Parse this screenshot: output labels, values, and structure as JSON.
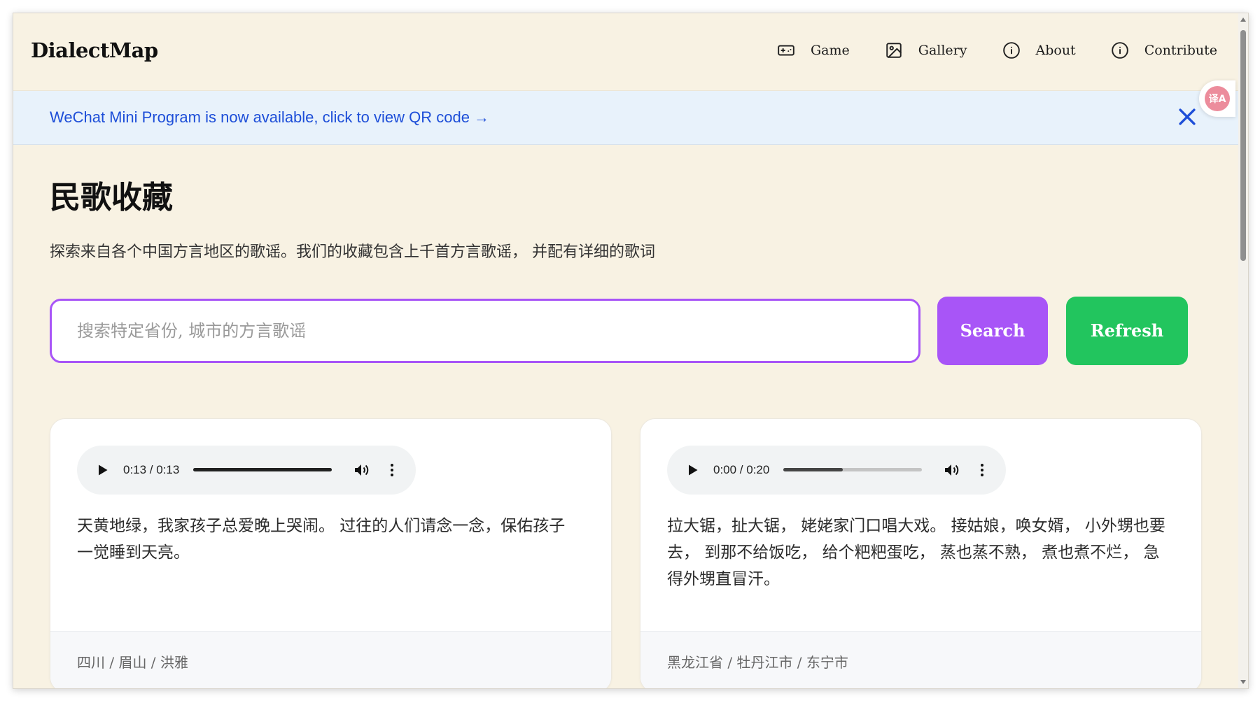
{
  "header": {
    "logo": "DialectMap",
    "nav": [
      {
        "label": "Game",
        "icon": "gamepad-icon"
      },
      {
        "label": "Gallery",
        "icon": "image-icon"
      },
      {
        "label": "About",
        "icon": "info-icon"
      },
      {
        "label": "Contribute",
        "icon": "info-icon"
      }
    ]
  },
  "translate": {
    "label": "译A",
    "icon": "translate-icon"
  },
  "banner": {
    "text": "WeChat Mini Program is now available, click to view QR code →",
    "close_icon": "close-icon"
  },
  "main": {
    "title": "民歌收藏",
    "subtitle": "探索来自各个中国方言地区的歌谣。我们的收藏包含上千首方言歌谣， 并配有详细的歌词",
    "search": {
      "placeholder": "搜索特定省份, 城市的方言歌谣",
      "value": "",
      "search_label": "Search",
      "refresh_label": "Refresh"
    },
    "songs": [
      {
        "audio": {
          "time": "0:13 / 0:13",
          "progress": 1.0
        },
        "lyrics": "天黄地绿，我家孩子总爱晚上哭闹。 过往的人们请念一念，保佑孩子一觉睡到天亮。",
        "location": "四川 / 眉山 / 洪雅"
      },
      {
        "audio": {
          "time": "0:00 / 0:20",
          "progress": 0.43
        },
        "lyrics": "拉大锯，扯大锯， 姥姥家门口唱大戏。 接姑娘，唤女婿， 小外甥也要去， 到那不给饭吃， 给个粑粑蛋吃， 蒸也蒸不熟， 煮也煮不烂， 急得外甥直冒汗。",
        "location": "黑龙江省 / 牡丹江市 / 东宁市"
      }
    ]
  },
  "colors": {
    "background": "#f8f2e3",
    "banner_bg": "#e8f2fb",
    "banner_text": "#1d4ed8",
    "accent_purple": "#a855f7",
    "accent_green": "#22c55e"
  }
}
